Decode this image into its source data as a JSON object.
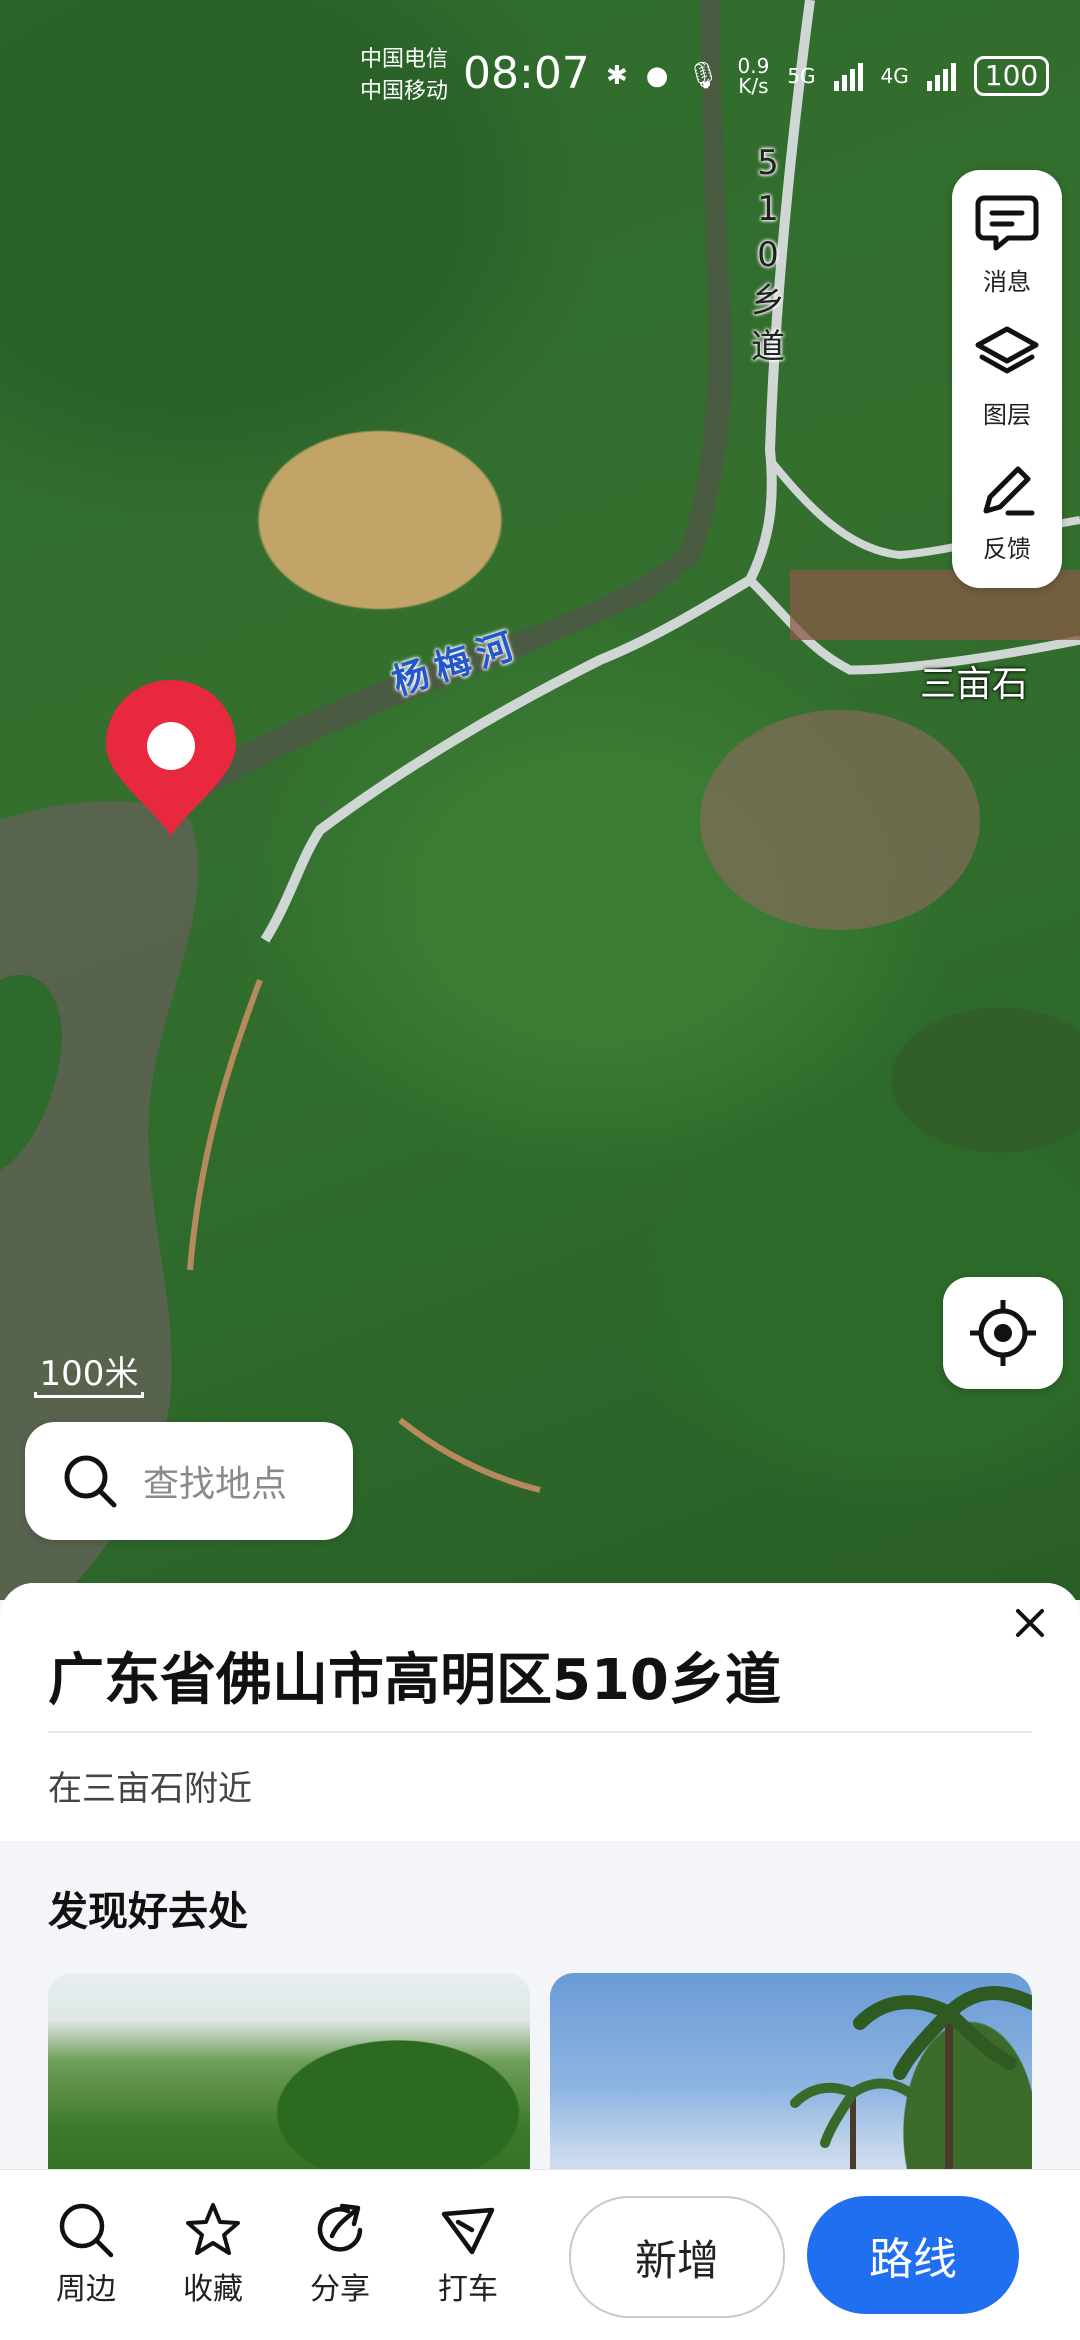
{
  "status_bar": {
    "carrier_1": "中国电信",
    "carrier_2": "中国移动",
    "time": "08:07",
    "net_speed_value": "0.9",
    "net_speed_unit": "K/s",
    "network_1": "5G",
    "network_2": "4G",
    "battery": "100"
  },
  "map": {
    "road_label": "510乡道",
    "river_label": "杨梅河",
    "village_label": "三亩石",
    "scale_label": "100米",
    "controls": [
      {
        "label": "消息",
        "icon": "message-icon"
      },
      {
        "label": "图层",
        "icon": "layers-icon"
      },
      {
        "label": "反馈",
        "icon": "feedback-pen-icon"
      }
    ],
    "search_placeholder": "查找地点"
  },
  "place": {
    "title": "广东省佛山市高明区510乡道",
    "subtitle": "在三亩石附近"
  },
  "discover": {
    "title": "发现好去处"
  },
  "bottom_nav": {
    "items": [
      {
        "label": "周边",
        "icon": "search-icon"
      },
      {
        "label": "收藏",
        "icon": "star-icon"
      },
      {
        "label": "分享",
        "icon": "share-icon"
      },
      {
        "label": "打车",
        "icon": "taxi-icon"
      }
    ],
    "add_label": "新增",
    "route_label": "路线"
  },
  "colors": {
    "accent": "#1f6ff0",
    "pin": "#e8283e"
  }
}
